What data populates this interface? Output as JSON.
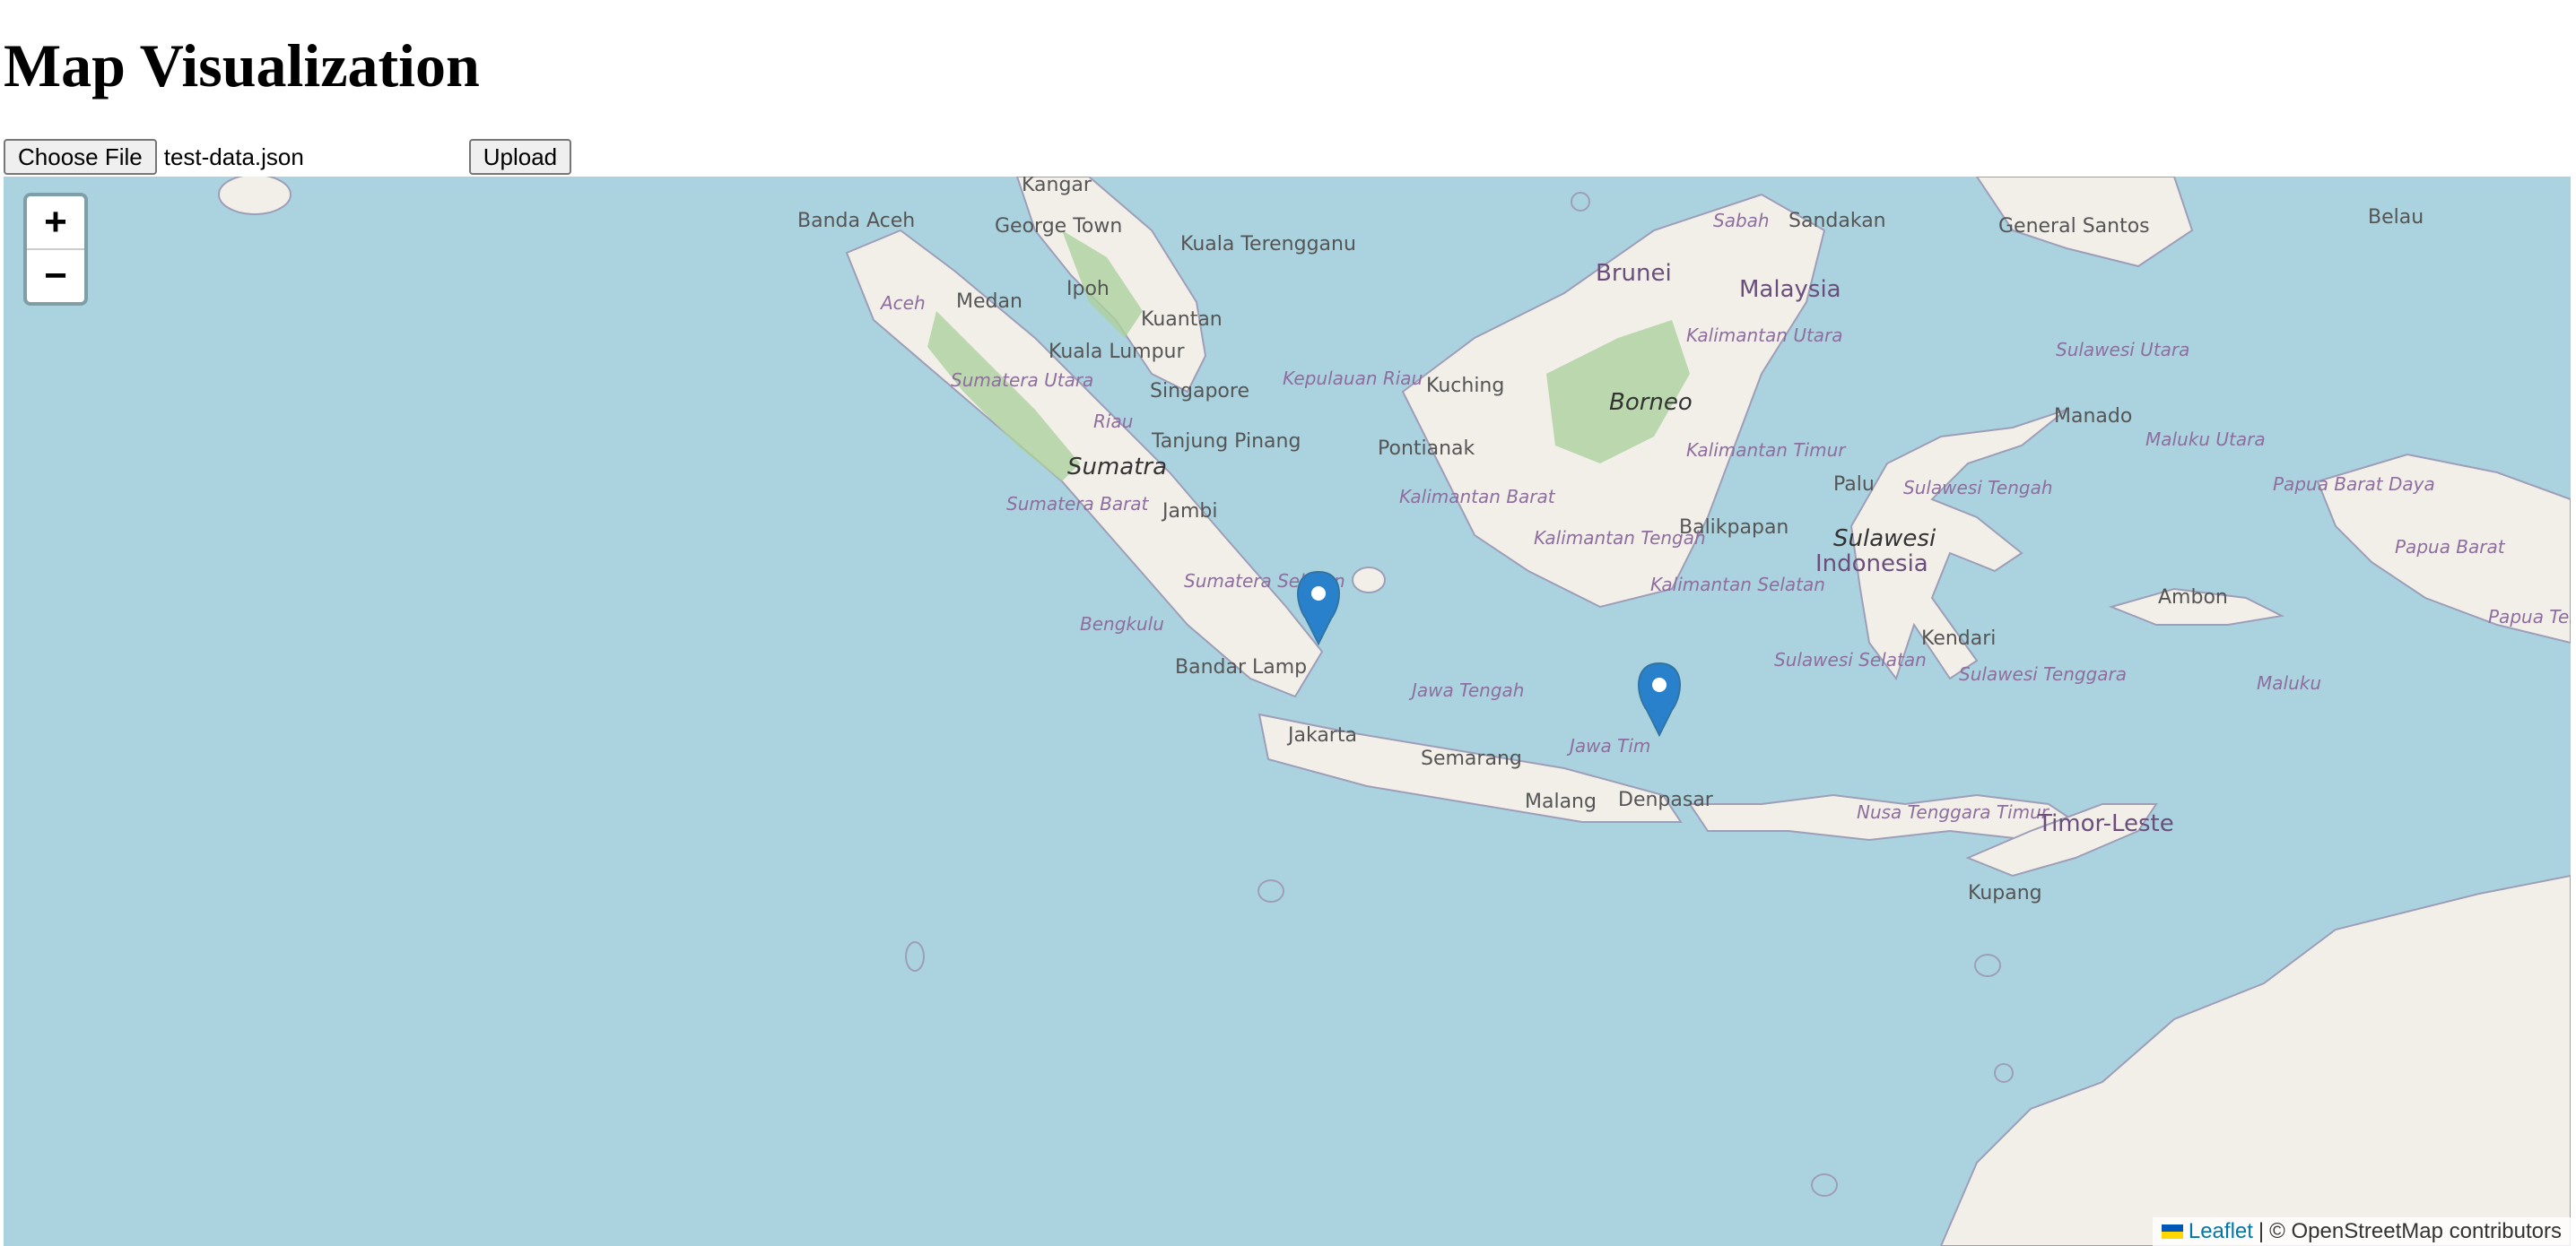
{
  "page": {
    "title": "Map Visualization"
  },
  "uploader": {
    "choose_label": "Choose File",
    "file_name": "test-data.json",
    "upload_label": "Upload"
  },
  "map": {
    "zoom_in": "+",
    "zoom_out": "−",
    "attribution": {
      "leaflet": "Leaflet",
      "separator": "|",
      "osm": "© OpenStreetMap contributors"
    },
    "labels": {
      "kangar": "Kangar",
      "banda_aceh": "Banda Aceh",
      "george_town": "George Town",
      "kuala_terengganu": "Kuala Terengganu",
      "sabah": "Sabah",
      "sandakan": "Sandakan",
      "general_santos": "General Santos",
      "belau": "Belau",
      "aceh": "Aceh",
      "medan": "Medan",
      "ipoh": "Ipoh",
      "kuantan": "Kuantan",
      "brunei": "Brunei",
      "malaysia": "Malaysia",
      "kuala_lumpur": "Kuala Lumpur",
      "sumatera_utara": "Sumatera Utara",
      "singapore": "Singapore",
      "kepulauan_riau": "Kepulauan Riau",
      "kuching": "Kuching",
      "borneo": "Borneo",
      "kalimantan_utara": "Kalimantan Utara",
      "sulawesi_utara": "Sulawesi Utara",
      "manado": "Manado",
      "riau": "Riau",
      "tanjung_pinang": "Tanjung Pinang",
      "pontianak": "Pontianak",
      "maluku_utara": "Maluku Utara",
      "sumatra": "Sumatra",
      "kalimantan_timur": "Kalimantan Timur",
      "palu": "Palu",
      "sulawesi_tengah": "Sulawesi Tengah",
      "papua_barat_daya": "Papua Barat Daya",
      "kalimantan_barat": "Kalimantan Barat",
      "sumatera_barat": "Sumatera Barat",
      "jambi": "Jambi",
      "balikpapan": "Balikpapan",
      "sulawesi": "Sulawesi",
      "papua_barat": "Papua Barat",
      "kalimantan_tengah": "Kalimantan Tengah",
      "indonesia": "Indonesia",
      "sumatera_selatan": "Sumatera Selatan",
      "kalimantan_selatan": "Kalimantan Selatan",
      "ambon": "Ambon",
      "papua_tengah": "Papua Ten",
      "bengkulu": "Bengkulu",
      "kendari": "Kendari",
      "bandar_lampung": "Bandar Lamp",
      "sulawesi_selatan": "Sulawesi Selatan",
      "sulawesi_tenggara": "Sulawesi Tenggara",
      "maluku": "Maluku",
      "jawa_tengah": "Jawa Tengah",
      "jakarta": "Jakarta",
      "semarang": "Semarang",
      "jawa_timur": "Jawa Tim",
      "malang": "Malang",
      "denpasar": "Denpasar",
      "nusa_tenggara_timur": "Nusa Tenggara Timur",
      "timor_leste": "Timor-Leste",
      "kupang": "Kupang"
    },
    "markers": [
      {
        "name": "Jakarta",
        "lat": -6.2,
        "lng": 106.8,
        "color": "#2a81cb"
      },
      {
        "name": "Denpasar",
        "lat": -8.65,
        "lng": 115.2,
        "color": "#2a81cb"
      }
    ]
  },
  "colors": {
    "sea": "#aad3df",
    "land": "#f2efe9",
    "forest": "#add19e",
    "boundary": "#9e9eb8",
    "marker": "#2a81cb",
    "link": "#0078a8"
  }
}
